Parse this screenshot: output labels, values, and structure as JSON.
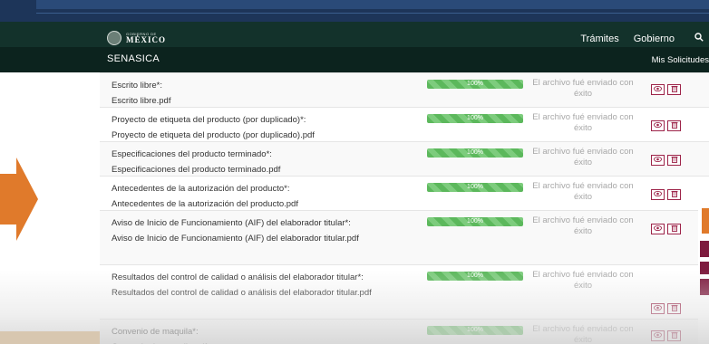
{
  "gob": {
    "logo_small": "GOBIERNO DE",
    "logo_big": "MÉXICO",
    "nav": [
      "Trámites",
      "Gobierno"
    ]
  },
  "sub": {
    "brand": "SENASICA",
    "link": "Mis Solicitudes"
  },
  "progress_label": "100%",
  "progress_value": 1.0,
  "rows": [
    {
      "name": "Escrito libre*:",
      "file": "Escrito libre.pdf",
      "status": "El archivo fué enviado con éxito"
    },
    {
      "name": "Proyecto de etiqueta del producto (por duplicado)*:",
      "file": "Proyecto de etiqueta del producto (por duplicado).pdf",
      "status": "El archivo fué enviado con éxito"
    },
    {
      "name": "Especificaciones del producto terminado*:",
      "file": "Especificaciones del producto terminado.pdf",
      "status": "El archivo fué enviado con éxito"
    },
    {
      "name": "Antecedentes de la autorización del producto*:",
      "file": "Antecedentes de la autorización del producto.pdf",
      "status": "El archivo fué enviado con éxito"
    },
    {
      "name": "Aviso de Inicio de Funcionamiento (AIF) del elaborador titular*:",
      "file": "Aviso de Inicio de Funcionamiento (AIF) del elaborador titular.pdf",
      "status": "El archivo fué enviado con éxito"
    },
    {
      "name": "Resultados del control de calidad o análisis del elaborador titular*:",
      "file": "Resultados del control de calidad o análisis del elaborador titular.pdf",
      "status": "El archivo fué enviado con éxito"
    },
    {
      "name": "Convenio de maquila*:",
      "file": "Convenio de maquila.pdf",
      "status": "El archivo fué enviado con éxito"
    }
  ],
  "colors": {
    "header": "#13322b",
    "subheader": "#0c231e",
    "accent": "#9d2449",
    "progress": "#5cb85c",
    "arrow": "#e07a2b"
  },
  "icons": {
    "view": "eye-icon",
    "delete": "trash-icon",
    "search": "search-icon"
  }
}
